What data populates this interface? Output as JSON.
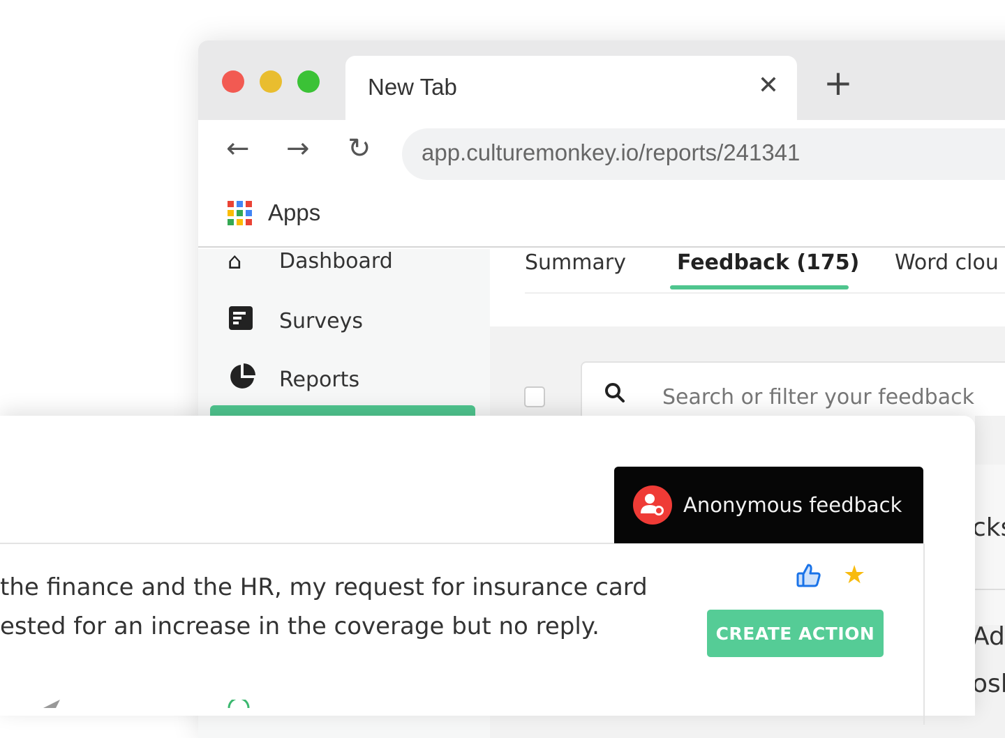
{
  "browser": {
    "tab_title": "New Tab",
    "tab_close_icon": "close-icon",
    "new_tab_icon": "plus-icon",
    "url": "app.culturemonkey.io/reports/241341",
    "bookmark_apps": "Apps",
    "traffic_lights": [
      "#f25a52",
      "#e9bd2f",
      "#3bc236"
    ]
  },
  "sidebar": {
    "items": [
      {
        "label": "Dashboard",
        "icon": "home-icon"
      },
      {
        "label": "Surveys",
        "icon": "survey-icon"
      },
      {
        "label": "Reports",
        "icon": "pie-chart-icon"
      }
    ]
  },
  "main": {
    "tabs": [
      {
        "label": "Summary"
      },
      {
        "label": "Feedback (175)",
        "active": true
      },
      {
        "label": "Word clou"
      }
    ],
    "search_placeholder": "Search or filter your feedback",
    "right_peek": [
      "cks",
      "Ada",
      "osl"
    ]
  },
  "card": {
    "badge": "Anonymous feedback",
    "feedback_lines": [
      "the finance and the HR, my request for insurance card",
      "ested for an increase in the coverage but no reply."
    ],
    "create_action": "CREATE ACTION"
  },
  "colors": {
    "accent": "#4fc58e",
    "badge_bg": "#060606",
    "anon_icon": "#ef3b36",
    "like": "#1a73e8",
    "star": "#f8bb0e"
  }
}
